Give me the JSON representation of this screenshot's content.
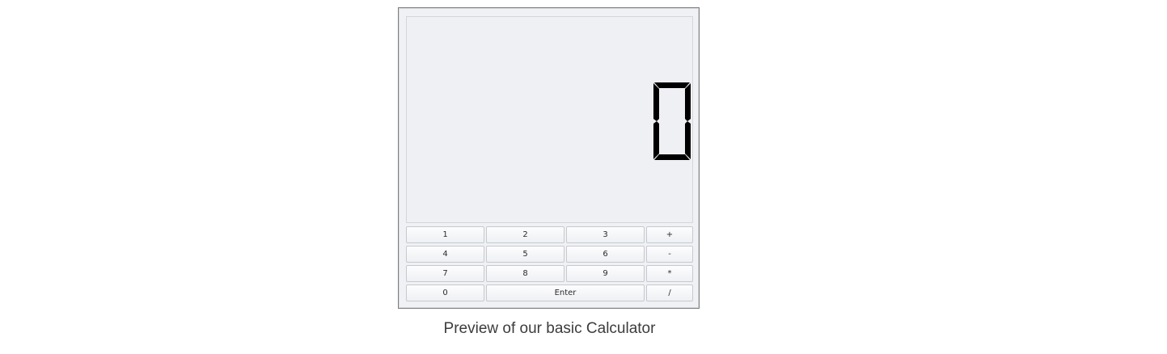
{
  "display": {
    "value": "0"
  },
  "keypad": {
    "row1": [
      "1",
      "2",
      "3",
      "+"
    ],
    "row2": [
      "4",
      "5",
      "6",
      "-"
    ],
    "row3": [
      "7",
      "8",
      "9",
      "*"
    ],
    "row4": [
      "0",
      "Enter",
      "/"
    ]
  },
  "caption": "Preview of our basic Calculator",
  "colors": {
    "window_bg": "#eff1f5",
    "lcd_segment": "#000000",
    "key_border": "#c6c9cf",
    "caption_text": "#3c3c3c"
  }
}
